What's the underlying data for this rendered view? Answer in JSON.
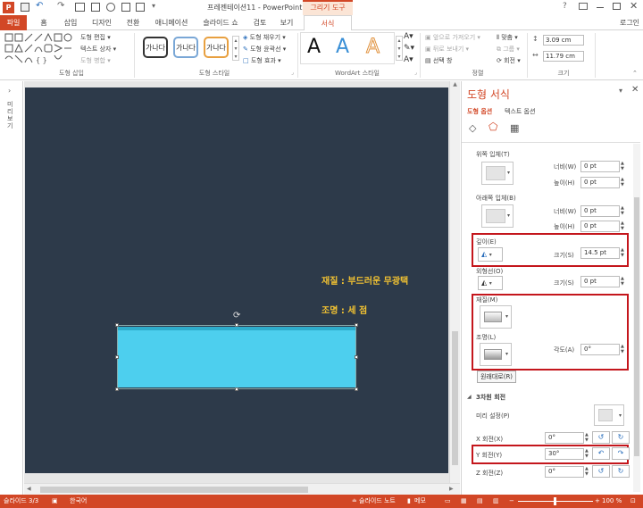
{
  "window": {
    "title": "프레젠테이션11 - PowerPoint",
    "context_group": "그리기 도구",
    "account": "로그인",
    "colors": {
      "accent": "#d24726",
      "slide_bg": "#2d3a4a",
      "shape_fill": "#4dcfee",
      "highlight": "#c4161c",
      "annotation": "#f1c232"
    }
  },
  "tabs": [
    {
      "label": "파일"
    },
    {
      "label": "홈"
    },
    {
      "label": "삽입"
    },
    {
      "label": "디자인"
    },
    {
      "label": "전환"
    },
    {
      "label": "애니메이션"
    },
    {
      "label": "슬라이드 쇼"
    },
    {
      "label": "검토"
    },
    {
      "label": "보기"
    },
    {
      "label": "서식"
    }
  ],
  "ribbon": {
    "insert_shapes": {
      "label": "도형 삽입",
      "edit_shape": "도형 편집",
      "text_box": "텍스트 상자",
      "merge_shapes": "도형 병합"
    },
    "shape_styles": {
      "label": "도형 스타일",
      "sample": "가나다",
      "fill": "도형 채우기",
      "outline": "도형 윤곽선",
      "effects": "도형 효과"
    },
    "wordart": {
      "label": "WordArt 스타일",
      "glyph": "A"
    },
    "arrange": {
      "label": "정렬",
      "bring_forward": "앞으로 가져오기",
      "send_backward": "뒤로 보내기",
      "selection_pane": "선택 창",
      "align": "맞춤",
      "group": "그룹",
      "rotate": "회전"
    },
    "size": {
      "label": "크기",
      "height": "3.09 cm",
      "width": "11.79 cm"
    }
  },
  "left_rail": {
    "label": "미리 보기"
  },
  "slide": {
    "material_text": "재질 : 부드러운 무광택",
    "lighting_text": "조명 : 세 점"
  },
  "pane": {
    "title": "도형 서식",
    "tab_shape": "도형 옵션",
    "tab_text": "텍스트 옵션",
    "top_bevel": "위쪽 입체(T)",
    "bottom_bevel": "아래쪽 입체(B)",
    "width_label": "너비(W)",
    "height_label": "높이(H)",
    "top_width": "0 pt",
    "top_height": "0 pt",
    "bottom_width": "0 pt",
    "bottom_height": "0 pt",
    "depth": "깊이(E)",
    "depth_size_label": "크기(S)",
    "depth_size": "14.5 pt",
    "contour": "외형선(O)",
    "contour_size_label": "크기(S)",
    "contour_size": "0 pt",
    "material": "재질(M)",
    "lighting": "조명(L)",
    "angle_label": "각도(A)",
    "angle": "0°",
    "reset": "원래대로(R)",
    "rotation_section": "3차원 회전",
    "presets": "미리 설정(P)",
    "x_rotation_label": "X 회전(X)",
    "x_rotation": "0°",
    "y_rotation_label": "Y 회전(Y)",
    "y_rotation": "30°",
    "z_rotation_label": "Z 회전(Z)",
    "z_rotation": "0°"
  },
  "status": {
    "slide": "슬라이드 3/3",
    "language": "한국어",
    "notes": "슬라이드 노트",
    "comments": "메모",
    "zoom": "100 %"
  }
}
